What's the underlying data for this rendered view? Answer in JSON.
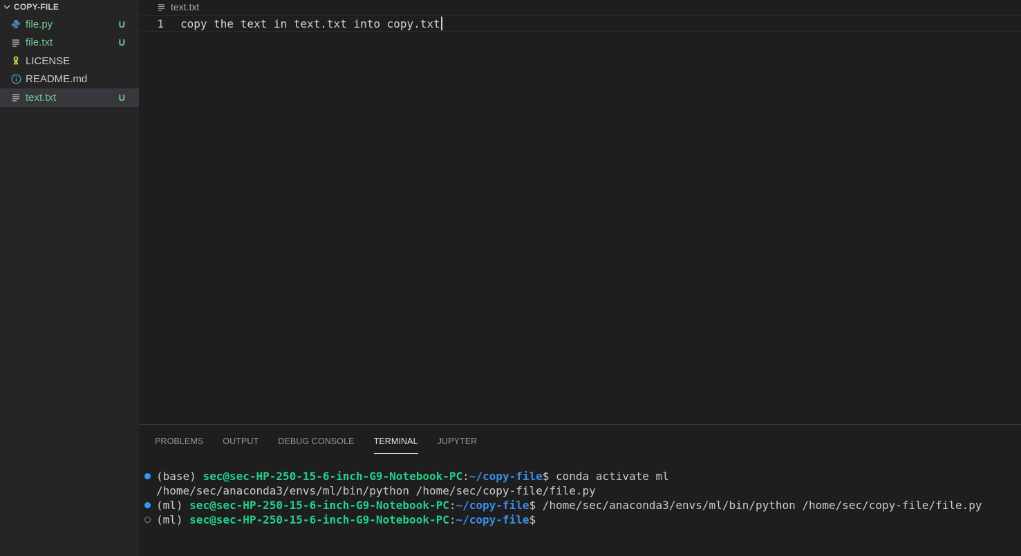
{
  "explorer": {
    "folder_name": "COPY-FILE",
    "files": [
      {
        "name": "file.py",
        "status": "U",
        "icon": "python-icon"
      },
      {
        "name": "file.txt",
        "status": "U",
        "icon": "text-file-icon"
      },
      {
        "name": "LICENSE",
        "status": "",
        "icon": "license-icon"
      },
      {
        "name": "README.md",
        "status": "",
        "icon": "info-icon"
      },
      {
        "name": "text.txt",
        "status": "U",
        "icon": "text-file-icon"
      }
    ]
  },
  "editor": {
    "breadcrumb": "text.txt",
    "lines": [
      {
        "number": "1",
        "text": "copy the text in text.txt into copy.txt"
      }
    ]
  },
  "panel": {
    "tabs": [
      "PROBLEMS",
      "OUTPUT",
      "DEBUG CONSOLE",
      "TERMINAL",
      "JUPYTER"
    ],
    "active_tab": "TERMINAL"
  },
  "terminal": {
    "lines": [
      {
        "env": "(base) ",
        "user": "sec@sec-HP-250-15-6-inch-G9-Notebook-PC",
        "sep": ":",
        "path": "~/copy-file",
        "cmd": "$ conda activate ml"
      },
      {
        "output": "/home/sec/anaconda3/envs/ml/bin/python /home/sec/copy-file/file.py"
      },
      {
        "env": "(ml) ",
        "user": "sec@sec-HP-250-15-6-inch-G9-Notebook-PC",
        "sep": ":",
        "path": "~/copy-file",
        "cmd": "$ /home/sec/anaconda3/envs/ml/bin/python /home/sec/copy-file/file.py"
      },
      {
        "env": "(ml) ",
        "user": "sec@sec-HP-250-15-6-inch-G9-Notebook-PC",
        "sep": ":",
        "path": "~/copy-file",
        "cmd": "$"
      }
    ]
  },
  "colors": {
    "untracked": "#73c991",
    "prompt_user": "#23d18b",
    "prompt_path": "#3b8eea",
    "status_dot": "#3794ff"
  }
}
